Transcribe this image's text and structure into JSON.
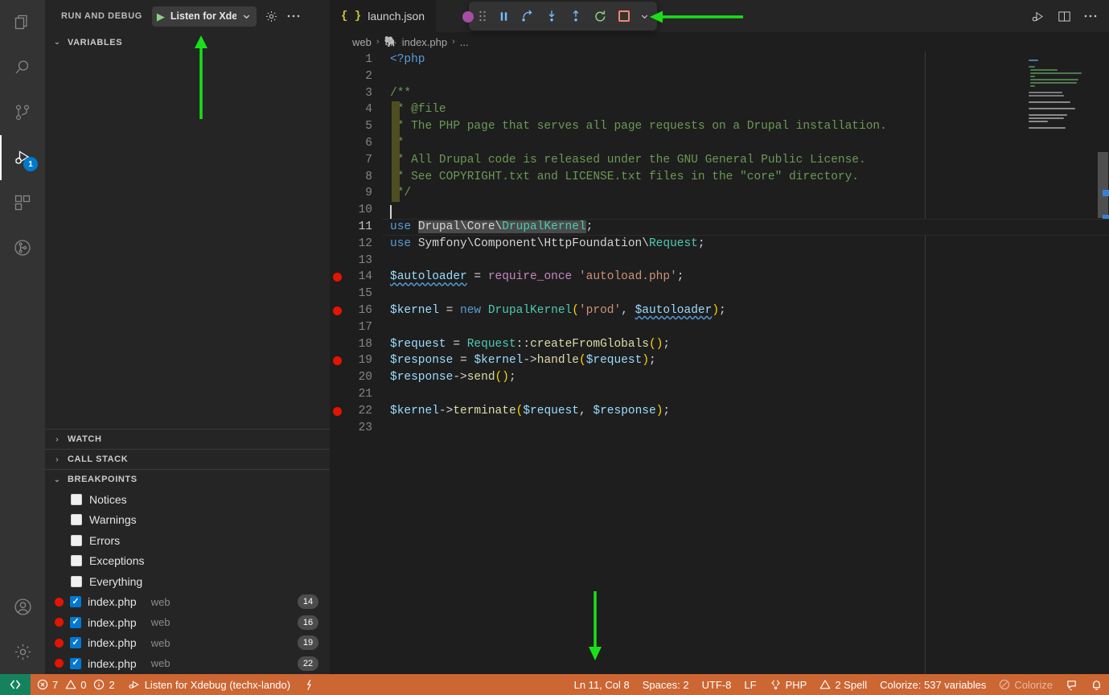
{
  "activitybar": {
    "items": [
      {
        "name": "explorer",
        "icon": "files-icon",
        "active": false
      },
      {
        "name": "search",
        "icon": "search-icon",
        "active": false
      },
      {
        "name": "source-control",
        "icon": "source-control-icon",
        "active": false
      },
      {
        "name": "run-and-debug",
        "icon": "run-and-debug-icon",
        "active": true,
        "badge": "1"
      },
      {
        "name": "extensions",
        "icon": "extensions-icon",
        "active": false
      },
      {
        "name": "git-graph",
        "icon": "git-graph-icon",
        "active": false
      }
    ],
    "bottom": [
      {
        "name": "accounts",
        "icon": "account-icon"
      },
      {
        "name": "manage",
        "icon": "gear-icon"
      }
    ]
  },
  "sidebar": {
    "title": "RUN AND DEBUG",
    "config_name": "Listen for Xdeb",
    "start_icon": "play-icon",
    "gear_icon": "gear-icon",
    "more_icon": "ellipsis-icon",
    "sections": [
      {
        "label": "VARIABLES",
        "expanded": true
      },
      {
        "label": "WATCH",
        "expanded": false
      },
      {
        "label": "CALL STACK",
        "expanded": false
      },
      {
        "label": "BREAKPOINTS",
        "expanded": true
      }
    ],
    "breakpoint_filters": [
      {
        "label": "Notices",
        "checked": false
      },
      {
        "label": "Warnings",
        "checked": false
      },
      {
        "label": "Errors",
        "checked": false
      },
      {
        "label": "Exceptions",
        "checked": false
      },
      {
        "label": "Everything",
        "checked": false
      }
    ],
    "breakpoints": [
      {
        "file": "index.php",
        "folder": "web",
        "line": "14",
        "checked": true
      },
      {
        "file": "index.php",
        "folder": "web",
        "line": "16",
        "checked": true
      },
      {
        "file": "index.php",
        "folder": "web",
        "line": "19",
        "checked": true
      },
      {
        "file": "index.php",
        "folder": "web",
        "line": "22",
        "checked": true
      }
    ]
  },
  "editor": {
    "tab": {
      "label": "launch.json",
      "icon": "json-icon"
    },
    "actions": [
      {
        "name": "run-or-debug",
        "icon": "run-debug-icon"
      },
      {
        "name": "split-editor",
        "icon": "split-editor-icon"
      },
      {
        "name": "more-actions",
        "icon": "ellipsis-icon"
      }
    ],
    "breadcrumb": {
      "root": "web",
      "file": "index.php",
      "trailing": "...",
      "file_icon": "php-elephant-icon",
      "separator": "›"
    },
    "cursor": {
      "line": 11,
      "column": 8
    },
    "lines": [
      {
        "n": 1,
        "bp": false,
        "text": "<?php"
      },
      {
        "n": 2,
        "bp": false,
        "text": ""
      },
      {
        "n": 3,
        "bp": false,
        "text": "/**"
      },
      {
        "n": 4,
        "bp": false,
        "text": " * @file"
      },
      {
        "n": 5,
        "bp": false,
        "text": " * The PHP page that serves all page requests on a Drupal installation."
      },
      {
        "n": 6,
        "bp": false,
        "text": " *"
      },
      {
        "n": 7,
        "bp": false,
        "text": " * All Drupal code is released under the GNU General Public License."
      },
      {
        "n": 8,
        "bp": false,
        "text": " * See COPYRIGHT.txt and LICENSE.txt files in the \"core\" directory."
      },
      {
        "n": 9,
        "bp": false,
        "text": " */"
      },
      {
        "n": 10,
        "bp": false,
        "text": ""
      },
      {
        "n": 11,
        "bp": false,
        "text": "use Drupal\\Core\\DrupalKernel;"
      },
      {
        "n": 12,
        "bp": false,
        "text": "use Symfony\\Component\\HttpFoundation\\Request;"
      },
      {
        "n": 13,
        "bp": false,
        "text": ""
      },
      {
        "n": 14,
        "bp": true,
        "text": "$autoloader = require_once 'autoload.php';"
      },
      {
        "n": 15,
        "bp": false,
        "text": ""
      },
      {
        "n": 16,
        "bp": true,
        "text": "$kernel = new DrupalKernel('prod', $autoloader);"
      },
      {
        "n": 17,
        "bp": false,
        "text": ""
      },
      {
        "n": 18,
        "bp": false,
        "text": "$request = Request::createFromGlobals();"
      },
      {
        "n": 19,
        "bp": true,
        "text": "$response = $kernel->handle($request);"
      },
      {
        "n": 20,
        "bp": false,
        "text": "$response->send();"
      },
      {
        "n": 21,
        "bp": false,
        "text": ""
      },
      {
        "n": 22,
        "bp": true,
        "text": "$kernel->terminate($request, $response);"
      },
      {
        "n": 23,
        "bp": false,
        "text": ""
      }
    ]
  },
  "debug_toolbar": {
    "buttons": [
      {
        "name": "drag-handle",
        "icon": "grip-dots-icon",
        "label": ""
      },
      {
        "name": "pause",
        "icon": "pause-icon",
        "label": "Pause"
      },
      {
        "name": "step-over",
        "icon": "step-over-icon",
        "label": "Step Over"
      },
      {
        "name": "step-into",
        "icon": "step-into-icon",
        "label": "Step Into"
      },
      {
        "name": "step-out",
        "icon": "step-out-icon",
        "label": "Step Out"
      },
      {
        "name": "restart",
        "icon": "restart-icon",
        "label": "Restart"
      },
      {
        "name": "stop",
        "icon": "stop-icon",
        "label": "Stop"
      },
      {
        "name": "more",
        "icon": "chevron-down-icon",
        "label": ""
      }
    ]
  },
  "statusbar": {
    "remote_icon": "remote-window-icon",
    "problems": {
      "errors_icon": "error-icon",
      "errors": "7",
      "warnings_icon": "warning-icon",
      "warnings": "0",
      "infos_icon": "info-icon",
      "infos": "2"
    },
    "debug_session": {
      "icon": "debug-alt-icon",
      "label": "Listen for Xdebug (techx-lando)"
    },
    "xdebug_icon": "lightning-icon",
    "right": [
      {
        "name": "cursor-position",
        "label": "Ln 11, Col 8"
      },
      {
        "name": "indentation",
        "label": "Spaces: 2"
      },
      {
        "name": "encoding",
        "label": "UTF-8"
      },
      {
        "name": "eol",
        "label": "LF"
      },
      {
        "name": "language-mode",
        "label": "PHP",
        "icon": "php-icon"
      },
      {
        "name": "spell-check",
        "label": "2 Spell",
        "icon": "warning-icon"
      },
      {
        "name": "colorize-count",
        "label": "Colorize: 537 variables"
      },
      {
        "name": "colorize-toggle",
        "label": "Colorize",
        "icon": "circle-slash-icon",
        "dimmed": true
      },
      {
        "name": "feedback",
        "icon": "feedback-icon",
        "label": ""
      },
      {
        "name": "notifications",
        "icon": "bell-icon",
        "label": ""
      }
    ]
  },
  "annotations": {
    "color": "#19e019",
    "arrows": [
      {
        "name": "arrow-to-config-dropdown",
        "direction": "up"
      },
      {
        "name": "arrow-to-debug-toolbar",
        "direction": "left"
      },
      {
        "name": "arrow-to-editor-bottom",
        "direction": "down"
      }
    ]
  }
}
